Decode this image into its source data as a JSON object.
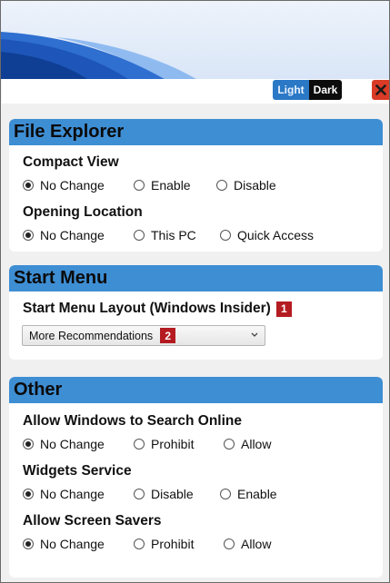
{
  "theme": {
    "light_label": "Light",
    "dark_label": "Dark",
    "accent": "#3e8ed4",
    "close_color": "#d93b26",
    "badge_color": "#b41c22"
  },
  "sections": {
    "file_explorer": {
      "title": "File Explorer",
      "compact_view": {
        "title": "Compact View",
        "options": [
          "No Change",
          "Enable",
          "Disable"
        ],
        "selected": "No Change"
      },
      "opening_location": {
        "title": "Opening Location",
        "options": [
          "No Change",
          "This PC",
          "Quick Access"
        ],
        "selected": "No Change"
      }
    },
    "start_menu": {
      "title": "Start Menu",
      "layout": {
        "title": "Start Menu Layout (Windows Insider)",
        "badge": "1",
        "dropdown_value": "More Recommendations",
        "dropdown_badge": "2"
      }
    },
    "other": {
      "title": "Other",
      "search_online": {
        "title": "Allow Windows to Search Online",
        "options": [
          "No Change",
          "Prohibit",
          "Allow"
        ],
        "selected": "No Change"
      },
      "widgets": {
        "title": "Widgets Service",
        "options": [
          "No Change",
          "Disable",
          "Enable"
        ],
        "selected": "No Change"
      },
      "screen_savers": {
        "title": "Allow Screen Savers",
        "options": [
          "No Change",
          "Prohibit",
          "Allow"
        ],
        "selected": "No Change"
      }
    }
  }
}
